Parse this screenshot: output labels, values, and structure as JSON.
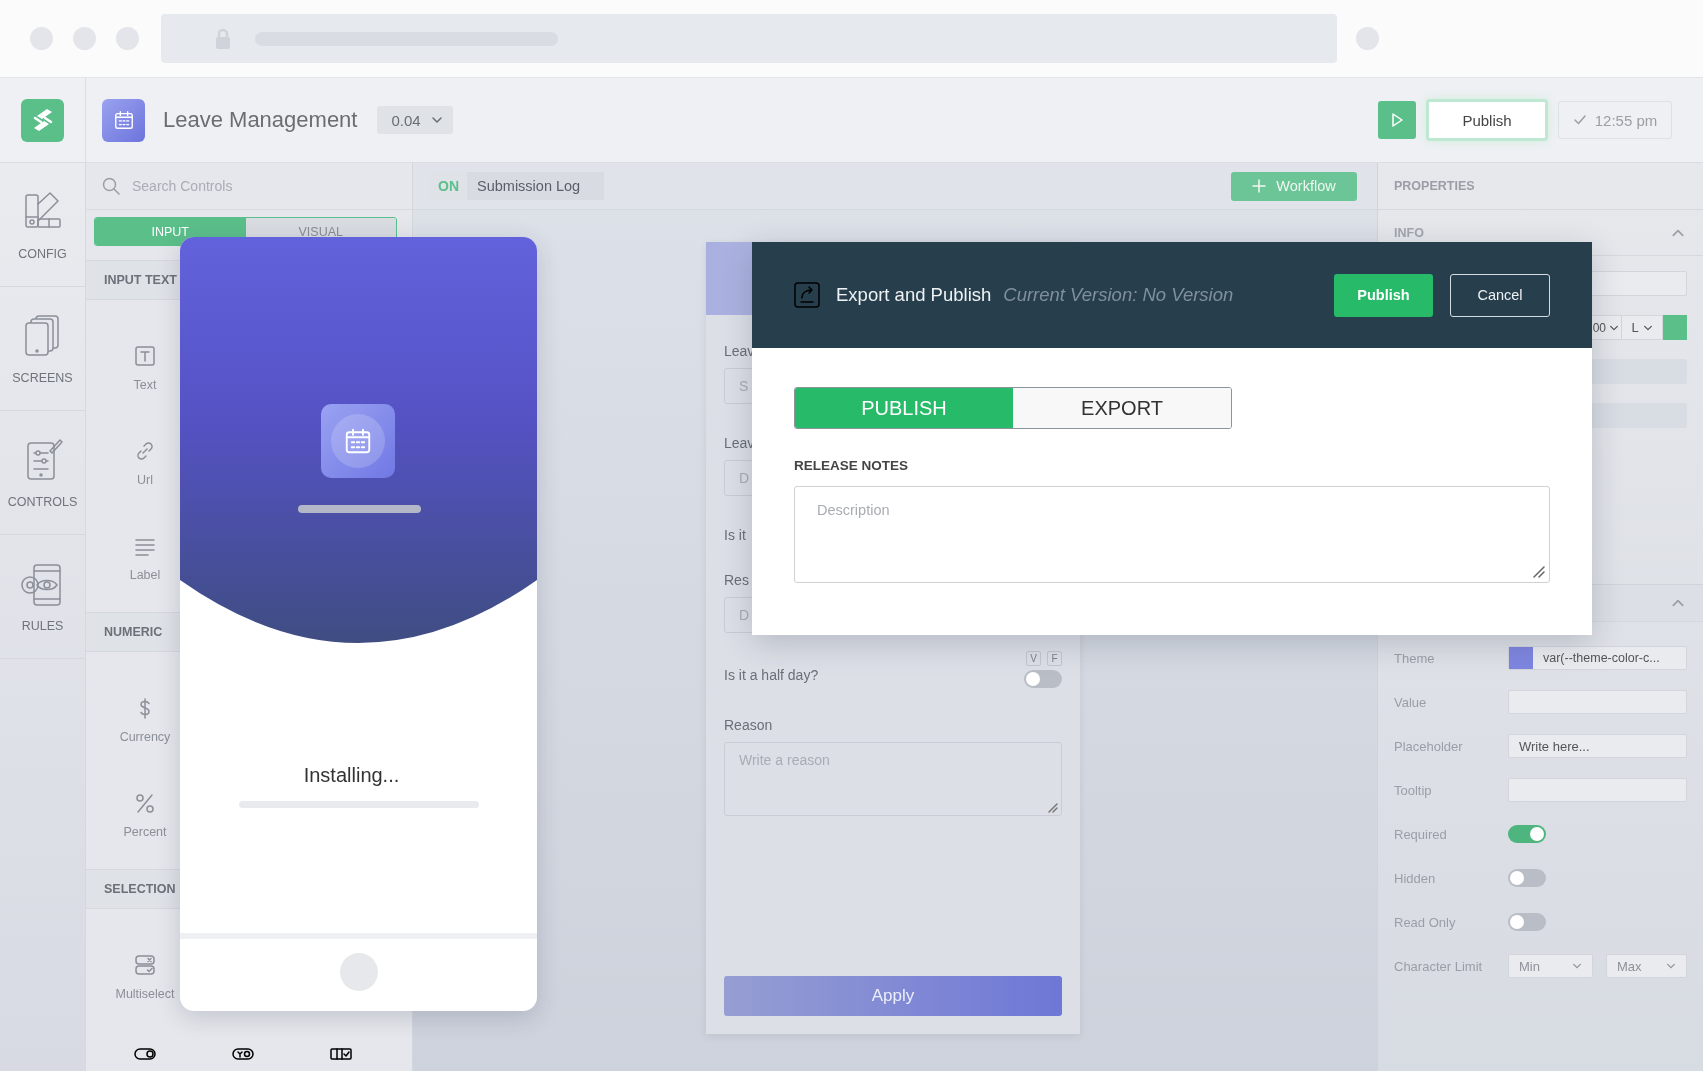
{
  "header": {
    "title": "Leave Management",
    "version": "0.04",
    "publish": "Publish",
    "time": {
      "label": "12:55 pm",
      "disabled": true
    }
  },
  "rail": [
    {
      "kind": "config",
      "label": "CONFIG"
    },
    {
      "kind": "screens",
      "label": "SCREENS"
    },
    {
      "kind": "controls",
      "label": "CONTROLS"
    },
    {
      "kind": "rules",
      "label": "RULES"
    }
  ],
  "controls": {
    "search_placeholder": "Search Controls",
    "tabs": [
      {
        "label": "INPUT",
        "selected": true
      },
      {
        "label": "VISUAL",
        "selected": false
      }
    ],
    "sections": [
      {
        "title": "INPUT TEXT",
        "items": [
          {
            "kind": "text",
            "label": "Text"
          },
          {
            "kind": "url",
            "label": "Url"
          },
          {
            "kind": "label",
            "label": "Label"
          }
        ]
      },
      {
        "title": "NUMERIC",
        "items": [
          {
            "kind": "currency",
            "label": "Currency"
          },
          {
            "kind": "percent",
            "label": "Percent"
          }
        ]
      },
      {
        "title": "SELECTION",
        "items": [
          {
            "kind": "multiselect",
            "label": "Multiselect"
          }
        ]
      }
    ],
    "more_icons": [
      {
        "kind": "switch"
      },
      {
        "kind": "yes-no"
      },
      {
        "kind": "checklist"
      }
    ]
  },
  "toolbar": {
    "status": "ON",
    "log": "Submission Log",
    "workflow": "Workflow"
  },
  "form": {
    "fields": [
      {
        "kind": "input",
        "label": "Leav",
        "placeholder": "S"
      },
      {
        "kind": "input",
        "label": "Leav",
        "placeholder": "D"
      },
      {
        "kind": "text",
        "label": "Is it"
      },
      {
        "kind": "input",
        "label": "Res",
        "placeholder": "D"
      },
      {
        "kind": "toggle",
        "label": "Is it a half day?",
        "on": false,
        "badges": [
          "V",
          "F"
        ]
      },
      {
        "kind": "textarea",
        "label": "Reason",
        "placeholder": "Write a reason"
      }
    ],
    "submit": "Apply"
  },
  "properties": {
    "title": "PROPERTIES",
    "info": {
      "title": "INFO",
      "expanded": true,
      "select_1": "00",
      "select_2": "L"
    },
    "section_2": {
      "expanded": true
    },
    "rows": [
      {
        "kind": "swatch",
        "label": "Theme",
        "value": "var(--theme-color-c..."
      },
      {
        "kind": "input",
        "label": "Value"
      },
      {
        "kind": "input",
        "label": "Placeholder",
        "value": "Write here..."
      },
      {
        "kind": "input",
        "label": "Tooltip"
      },
      {
        "kind": "toggle",
        "label": "Required",
        "on": true
      },
      {
        "kind": "toggle",
        "label": "Hidden",
        "on": false
      },
      {
        "kind": "toggle",
        "label": "Read Only",
        "on": false
      },
      {
        "kind": "range",
        "label": "Character Limit",
        "min": "Min",
        "max": "Max"
      }
    ]
  },
  "phone": {
    "status": "Installing..."
  },
  "modal": {
    "title": "Export and Publish",
    "subtitle": "Current Version: No Version",
    "publish": "Publish",
    "cancel": "Cancel",
    "tabs": [
      {
        "label": "PUBLISH",
        "selected": true
      },
      {
        "label": "EXPORT",
        "selected": false
      }
    ],
    "notes_label": "RELEASE NOTES",
    "notes_placeholder": "Description"
  }
}
